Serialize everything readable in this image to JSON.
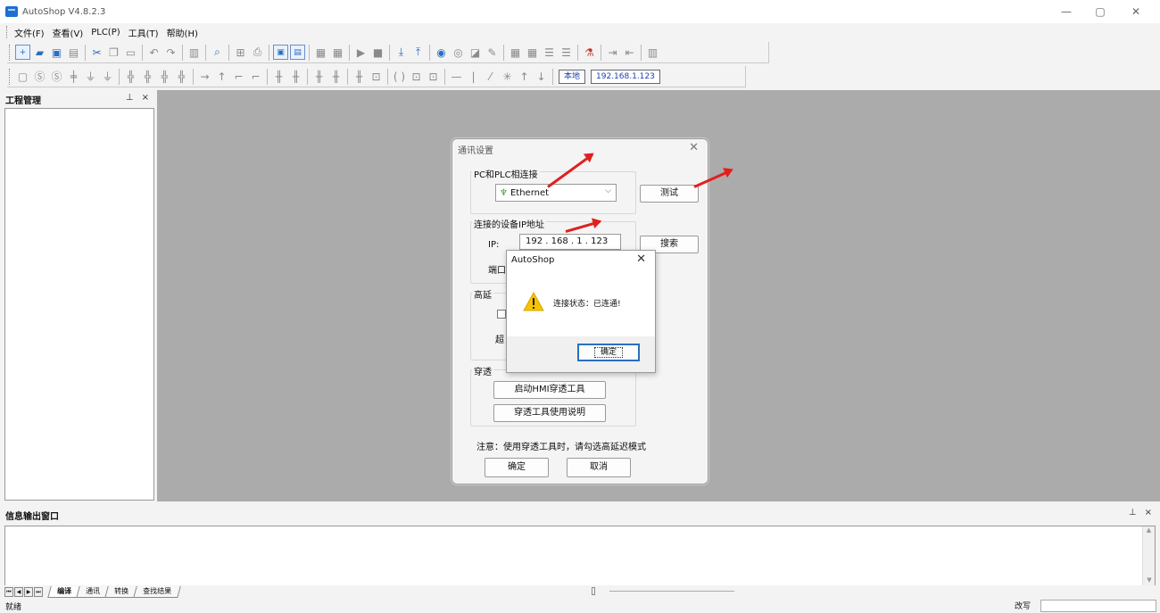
{
  "window": {
    "title": "AutoShop V4.8.2.3",
    "minimize_glyph": "—",
    "maximize_glyph": "▢",
    "close_glyph": "✕"
  },
  "menu": {
    "items": [
      "文件(F)",
      "查看(V)",
      "PLC(P)",
      "工具(T)",
      "帮助(H)"
    ]
  },
  "toolbar2": {
    "local_label": "本地",
    "ip_label": "192.168.1.123"
  },
  "project_panel": {
    "title": "工程管理",
    "controls": "⊥ ×"
  },
  "output_panel": {
    "title": "信息输出窗口",
    "controls": "⊥ ×",
    "tabs": [
      "编译",
      "通讯",
      "转换",
      "查找结果"
    ],
    "active_tab": "编译"
  },
  "status": {
    "left": "就绪",
    "right": "改写"
  },
  "comm_dialog": {
    "title": "通讯设置",
    "group_connect": "PC和PLC相连接",
    "connection_type": "Ethernet",
    "test_button": "测试",
    "group_ip": "连接的设备IP地址",
    "ip_label": "IP:",
    "ip_value": "192 . 168 .  1  . 123",
    "search_button": "搜索",
    "port_partial": "端口",
    "latency_partial": "高延",
    "timeout_partial": "超",
    "passthru_partial": "穿透",
    "hmi_button": "启动HMI穿透工具",
    "guide_button": "穿透工具使用说明",
    "note": "注意：使用穿透工具时，请勾选高延迟模式",
    "ok_button": "确定",
    "cancel_button": "取消"
  },
  "message_box": {
    "title": "AutoShop",
    "text": "连接状态：已连通!",
    "ok_button": "确定"
  },
  "colors": {
    "workspace": "#ababab",
    "arrow": "#e02020",
    "accent": "#2a6fbf"
  }
}
